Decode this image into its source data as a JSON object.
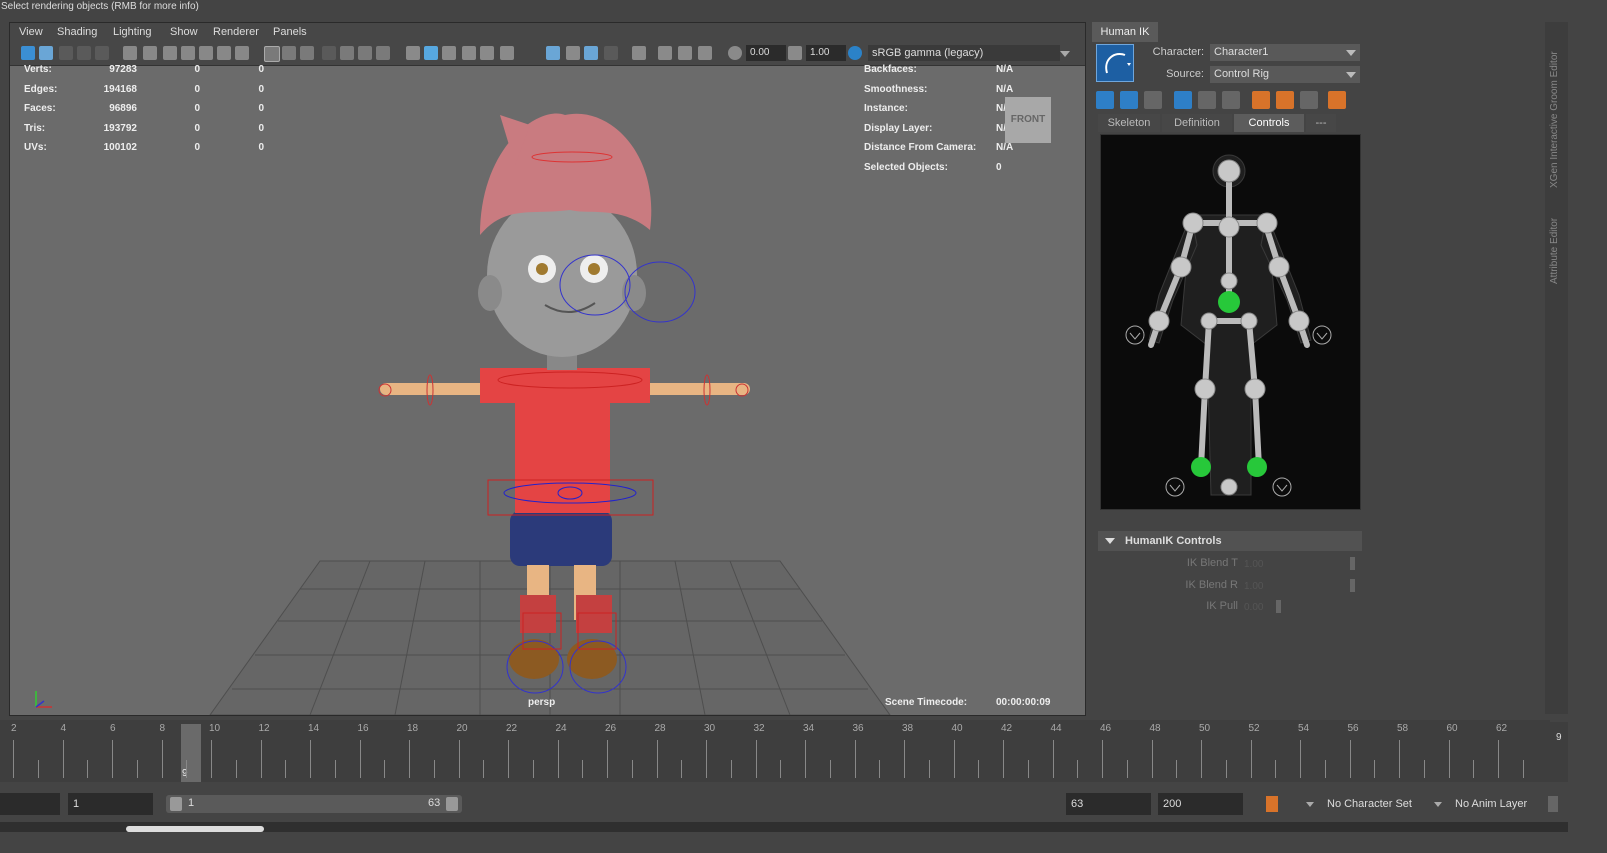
{
  "status_line": "Select rendering objects (RMB for more info)",
  "viewport": {
    "menu": [
      "View",
      "Shading",
      "Lighting",
      "Show",
      "Renderer",
      "Panels"
    ],
    "exposure": "0.00",
    "gamma": "1.00",
    "color_space": "sRGB gamma (legacy)",
    "hud_left": [
      {
        "label": "Verts:",
        "v1": "97283",
        "v2": "0",
        "v3": "0"
      },
      {
        "label": "Edges:",
        "v1": "194168",
        "v2": "0",
        "v3": "0"
      },
      {
        "label": "Faces:",
        "v1": "96896",
        "v2": "0",
        "v3": "0"
      },
      {
        "label": "Tris:",
        "v1": "193792",
        "v2": "0",
        "v3": "0"
      },
      {
        "label": "UVs:",
        "v1": "100102",
        "v2": "0",
        "v3": "0"
      }
    ],
    "hud_right": [
      {
        "label": "Backfaces:",
        "value": "N/A"
      },
      {
        "label": "Smoothness:",
        "value": "N/A"
      },
      {
        "label": "Instance:",
        "value": "N/A"
      },
      {
        "label": "Display Layer:",
        "value": "N/A"
      },
      {
        "label": "Distance From Camera:",
        "value": "N/A"
      },
      {
        "label": "Selected Objects:",
        "value": "0"
      }
    ],
    "viewcube_label": "FRONT",
    "camera_name": "persp",
    "timecode_label": "Scene Timecode:",
    "timecode_value": "00:00:00:09"
  },
  "human_ik": {
    "tab": "Human IK",
    "character_label": "Character:",
    "character_value": "Character1",
    "source_label": "Source:",
    "source_value": "Control Rig",
    "subtabs": [
      "Skeleton",
      "Definition",
      "Controls",
      "---"
    ],
    "active_subtab": "Controls",
    "controls_header": "HumanIK Controls",
    "sliders": [
      {
        "label": "IK Blend T",
        "value": "1.00"
      },
      {
        "label": "IK Blend R",
        "value": "1.00"
      },
      {
        "label": "IK Pull",
        "value": "0.00"
      }
    ]
  },
  "side_tabs": [
    "XGen Interactive Groom Editor",
    "Attribute Editor"
  ],
  "timeline": {
    "ticks": [
      "2",
      "4",
      "6",
      "8",
      "10",
      "12",
      "14",
      "16",
      "18",
      "20",
      "22",
      "24",
      "26",
      "28",
      "30",
      "32",
      "34",
      "36",
      "38",
      "40",
      "42",
      "44",
      "46",
      "48",
      "50",
      "52",
      "54",
      "56",
      "58",
      "60",
      "62"
    ],
    "current_frame": "9",
    "current_frame_right": "9"
  },
  "range": {
    "start": "1",
    "slider_start": "1",
    "slider_end": "63",
    "end": "63",
    "anim_end": "200",
    "character_set": "No Character Set",
    "anim_layer": "No Anim Layer"
  },
  "colors": {
    "accent": "#1f8ad0",
    "rig_green": "#27c83a",
    "rig_red": "#d44242"
  }
}
